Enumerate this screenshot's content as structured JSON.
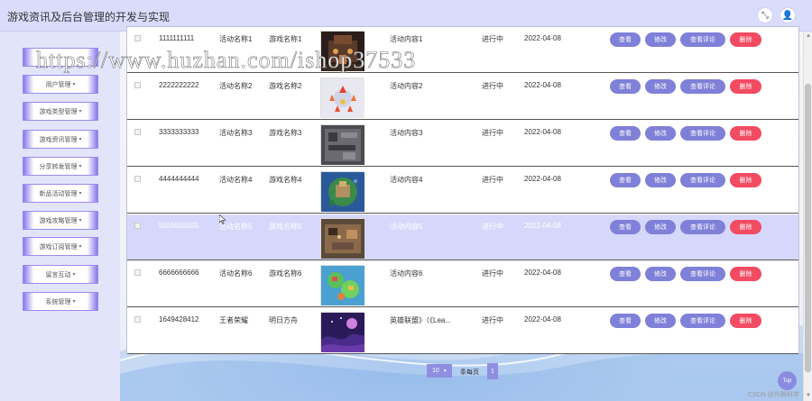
{
  "header": {
    "title": "游戏资讯及后台管理的开发与实现",
    "icons": [
      "fullscreen-icon",
      "user-icon"
    ],
    "fullscreen_glyph": "⤡",
    "user_glyph": "👤"
  },
  "sidebar": {
    "caret": "▾",
    "items": [
      {
        "label": ""
      },
      {
        "label": "用户管理"
      },
      {
        "label": "游戏类型管理"
      },
      {
        "label": "游戏资讯管理"
      },
      {
        "label": "分享转发管理"
      },
      {
        "label": "新品活动管理"
      },
      {
        "label": "游戏攻略管理"
      },
      {
        "label": "游戏订阅管理"
      },
      {
        "label": "留言互动"
      },
      {
        "label": "系统管理"
      }
    ]
  },
  "table": {
    "actions": {
      "view": "查看",
      "edit": "修改",
      "comment": "查看评论",
      "delete": "删除"
    },
    "rows": [
      {
        "id": "1111111111",
        "activity": "活动名称1",
        "game": "游戏名称1",
        "content": "活动内容1",
        "status": "进行中",
        "date": "2022-04-08",
        "thumb": "dark-castle"
      },
      {
        "id": "2222222222",
        "activity": "活动名称2",
        "game": "游戏名称2",
        "content": "活动内容2",
        "status": "进行中",
        "date": "2022-04-08",
        "thumb": "fire-pieces"
      },
      {
        "id": "3333333333",
        "activity": "活动名称3",
        "game": "游戏名称3",
        "content": "活动内容3",
        "status": "进行中",
        "date": "2022-04-08",
        "thumb": "stone-maze"
      },
      {
        "id": "4444444444",
        "activity": "活动名称4",
        "game": "游戏名称4",
        "content": "活动内容4",
        "status": "进行中",
        "date": "2022-04-08",
        "thumb": "island-fortress"
      },
      {
        "id": "5555555555",
        "activity": "活动名称5",
        "game": "游戏名称5",
        "content": "活动内容5",
        "status": "进行中",
        "date": "2022-04-08",
        "thumb": "battlefield"
      },
      {
        "id": "6666666666",
        "activity": "活动名称6",
        "game": "游戏名称6",
        "content": "活动内容6",
        "status": "进行中",
        "date": "2022-04-08",
        "thumb": "colorful-map"
      },
      {
        "id": "1649428412",
        "activity": "王者荣耀",
        "game": "明日方舟",
        "content": "英雄联盟》（《Lea...",
        "status": "进行中",
        "date": "2022-04-08",
        "thumb": "purple-night"
      }
    ],
    "highlighted_row": 4
  },
  "pagination": {
    "page_size": "10",
    "page_size_caret": "▾",
    "per_page_label": "条每页",
    "current_page": "1"
  },
  "scrollbar": {
    "up": "▲",
    "down": "▼"
  },
  "top_button": "Top",
  "watermark": "https://www.huzhan.com/ishop37533",
  "credit": "CSDN @升腾科学"
}
